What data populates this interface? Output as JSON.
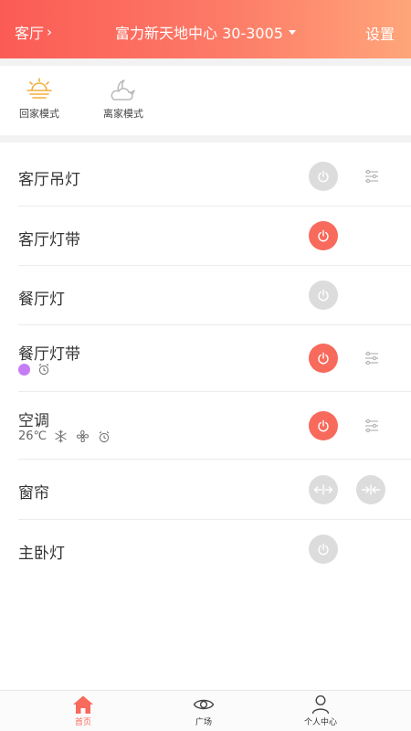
{
  "header": {
    "room": "客厅",
    "title": "富力新天地中心 30-3005",
    "settings": "设置"
  },
  "modes": [
    {
      "label": "回家模式",
      "icon": "sunrise-icon"
    },
    {
      "label": "离家模式",
      "icon": "moon-cloud-icon"
    }
  ],
  "devices": [
    {
      "name": "客厅吊灯",
      "power": "off",
      "has_adjust": true
    },
    {
      "name": "客厅灯带",
      "power": "on",
      "has_adjust": false
    },
    {
      "name": "餐厅灯",
      "power": "off",
      "has_adjust": false
    },
    {
      "name": "餐厅灯带",
      "power": "on",
      "has_adjust": true,
      "color": "#c57cf4"
    },
    {
      "name": "空调",
      "power": "on",
      "has_adjust": true,
      "temperature": "26℃"
    },
    {
      "name": "窗帘"
    },
    {
      "name": "主卧灯",
      "power": "off",
      "has_adjust": false
    }
  ],
  "colors": {
    "accent": "#f86a5c",
    "inactive": "#dcdcdc",
    "light_color": "#c57cf4"
  },
  "tabs": [
    {
      "label": "首页",
      "icon": "home-icon",
      "active": true
    },
    {
      "label": "广场",
      "icon": "eye-icon",
      "active": false
    },
    {
      "label": "个人中心",
      "icon": "person-icon",
      "active": false
    }
  ]
}
